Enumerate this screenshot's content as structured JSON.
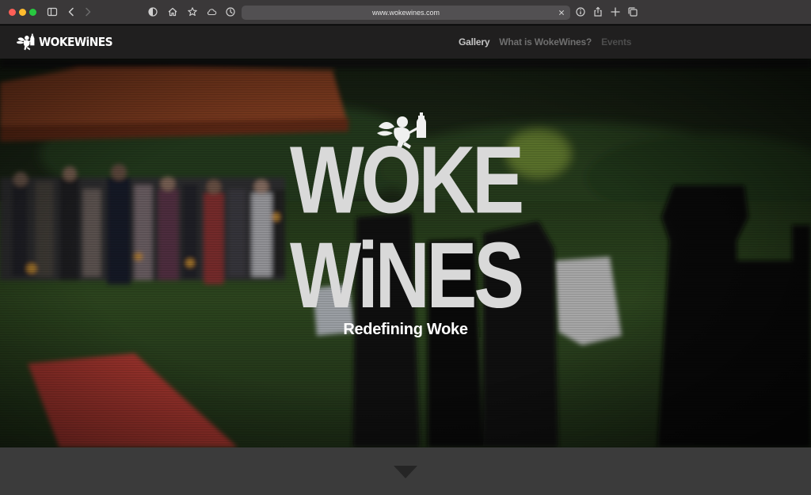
{
  "browser": {
    "url": "www.wokewines.com",
    "icons": [
      "sidebar-icon",
      "back-icon",
      "forward-icon",
      "shield-icon",
      "home-icon",
      "star-icon",
      "cloud-icon",
      "history-icon",
      "clear-icon",
      "info-icon",
      "share-icon",
      "new-tab-icon",
      "tabs-overview-icon"
    ]
  },
  "site": {
    "logo_text": "WOKEWiNES",
    "nav": [
      "Gallery",
      "What is WokeWines?",
      "Events",
      "",
      ""
    ]
  },
  "hero": {
    "wordmark_line1": "WOKE",
    "wordmark_line2": "WiNES",
    "tagline": "Redefining Woke"
  },
  "colors": {
    "header_bg": "#201f1f",
    "chrome_bg": "#3a3839",
    "wordmark": "#d9d9d9",
    "bottom_bar": "#3b3b3b"
  }
}
